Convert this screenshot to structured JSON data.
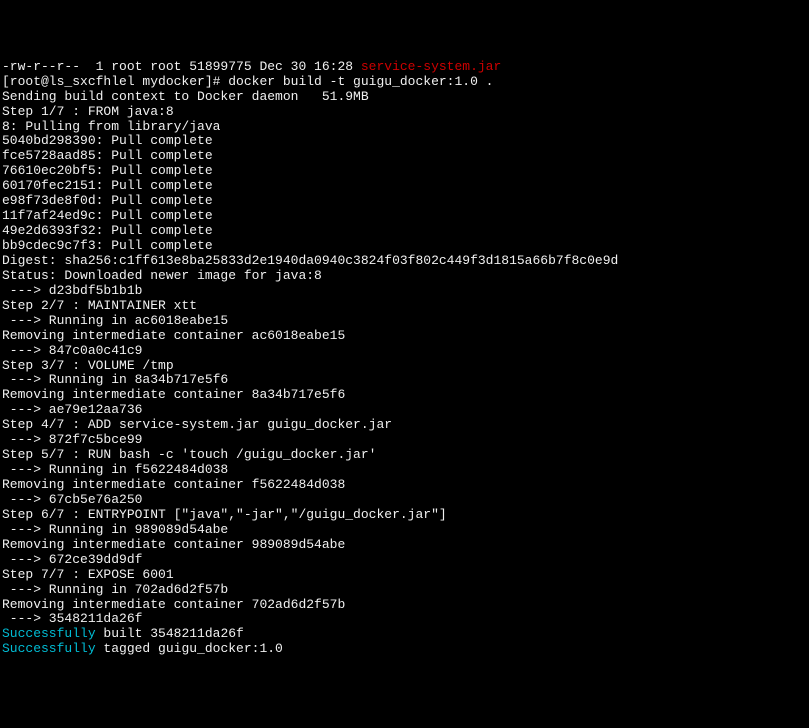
{
  "lines": [
    {
      "parts": [
        {
          "text": "-rw-r--r--  1 root root 51899775 Dec 30 16:28 ",
          "class": "white"
        },
        {
          "text": "service-system.jar",
          "class": "red"
        }
      ]
    },
    {
      "parts": [
        {
          "text": "[root@ls_sxcfhlel mydocker]# docker build -t guigu_docker:1.0 .",
          "class": "white"
        }
      ]
    },
    {
      "parts": [
        {
          "text": "Sending build context to Docker daemon   51.9MB",
          "class": "white"
        }
      ]
    },
    {
      "parts": [
        {
          "text": "Step 1/7 : FROM java:8",
          "class": "white"
        }
      ]
    },
    {
      "parts": [
        {
          "text": "8: Pulling from library/java",
          "class": "white"
        }
      ]
    },
    {
      "parts": [
        {
          "text": "5040bd298390: Pull complete",
          "class": "white"
        }
      ]
    },
    {
      "parts": [
        {
          "text": "fce5728aad85: Pull complete",
          "class": "white"
        }
      ]
    },
    {
      "parts": [
        {
          "text": "76610ec20bf5: Pull complete",
          "class": "white"
        }
      ]
    },
    {
      "parts": [
        {
          "text": "60170fec2151: Pull complete",
          "class": "white"
        }
      ]
    },
    {
      "parts": [
        {
          "text": "e98f73de8f0d: Pull complete",
          "class": "white"
        }
      ]
    },
    {
      "parts": [
        {
          "text": "11f7af24ed9c: Pull complete",
          "class": "white"
        }
      ]
    },
    {
      "parts": [
        {
          "text": "49e2d6393f32: Pull complete",
          "class": "white"
        }
      ]
    },
    {
      "parts": [
        {
          "text": "bb9cdec9c7f3: Pull complete",
          "class": "white"
        }
      ]
    },
    {
      "parts": [
        {
          "text": "Digest: sha256:c1ff613e8ba25833d2e1940da0940c3824f03f802c449f3d1815a66b7f8c0e9d",
          "class": "white"
        }
      ]
    },
    {
      "parts": [
        {
          "text": "Status: Downloaded newer image for java:8",
          "class": "white"
        }
      ]
    },
    {
      "parts": [
        {
          "text": " ---> d23bdf5b1b1b",
          "class": "white"
        }
      ]
    },
    {
      "parts": [
        {
          "text": "Step 2/7 : MAINTAINER xtt",
          "class": "white"
        }
      ]
    },
    {
      "parts": [
        {
          "text": " ---> Running in ac6018eabe15",
          "class": "white"
        }
      ]
    },
    {
      "parts": [
        {
          "text": "Removing intermediate container ac6018eabe15",
          "class": "white"
        }
      ]
    },
    {
      "parts": [
        {
          "text": " ---> 847c0a0c41c9",
          "class": "white"
        }
      ]
    },
    {
      "parts": [
        {
          "text": "Step 3/7 : VOLUME /tmp",
          "class": "white"
        }
      ]
    },
    {
      "parts": [
        {
          "text": " ---> Running in 8a34b717e5f6",
          "class": "white"
        }
      ]
    },
    {
      "parts": [
        {
          "text": "Removing intermediate container 8a34b717e5f6",
          "class": "white"
        }
      ]
    },
    {
      "parts": [
        {
          "text": " ---> ae79e12aa736",
          "class": "white"
        }
      ]
    },
    {
      "parts": [
        {
          "text": "Step 4/7 : ADD service-system.jar guigu_docker.jar",
          "class": "white"
        }
      ]
    },
    {
      "parts": [
        {
          "text": " ---> 872f7c5bce99",
          "class": "white"
        }
      ]
    },
    {
      "parts": [
        {
          "text": "Step 5/7 : RUN bash -c 'touch /guigu_docker.jar'",
          "class": "white"
        }
      ]
    },
    {
      "parts": [
        {
          "text": " ---> Running in f5622484d038",
          "class": "white"
        }
      ]
    },
    {
      "parts": [
        {
          "text": "Removing intermediate container f5622484d038",
          "class": "white"
        }
      ]
    },
    {
      "parts": [
        {
          "text": " ---> 67cb5e76a250",
          "class": "white"
        }
      ]
    },
    {
      "parts": [
        {
          "text": "Step 6/7 : ENTRYPOINT [\"java\",\"-jar\",\"/guigu_docker.jar\"]",
          "class": "white"
        }
      ]
    },
    {
      "parts": [
        {
          "text": " ---> Running in 989089d54abe",
          "class": "white"
        }
      ]
    },
    {
      "parts": [
        {
          "text": "Removing intermediate container 989089d54abe",
          "class": "white"
        }
      ]
    },
    {
      "parts": [
        {
          "text": " ---> 672ce39dd9df",
          "class": "white"
        }
      ]
    },
    {
      "parts": [
        {
          "text": "Step 7/7 : EXPOSE 6001",
          "class": "white"
        }
      ]
    },
    {
      "parts": [
        {
          "text": " ---> Running in 702ad6d2f57b",
          "class": "white"
        }
      ]
    },
    {
      "parts": [
        {
          "text": "Removing intermediate container 702ad6d2f57b",
          "class": "white"
        }
      ]
    },
    {
      "parts": [
        {
          "text": " ---> 3548211da26f",
          "class": "white"
        }
      ]
    },
    {
      "parts": [
        {
          "text": "Successfully",
          "class": "cyan"
        },
        {
          "text": " built 3548211da26f",
          "class": "white"
        }
      ]
    },
    {
      "parts": [
        {
          "text": "Successfully",
          "class": "cyan"
        },
        {
          "text": " tagged guigu_docker:1.0",
          "class": "white"
        }
      ]
    }
  ]
}
